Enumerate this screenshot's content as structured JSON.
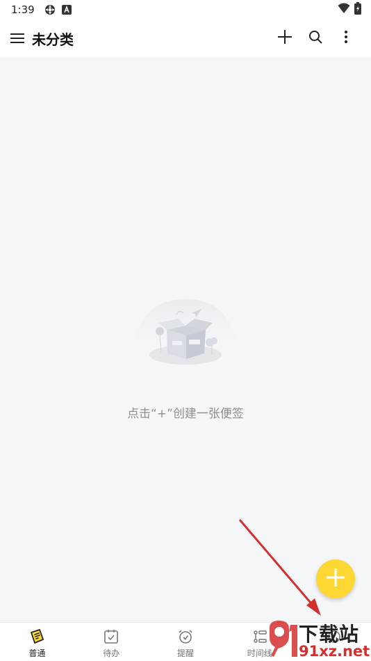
{
  "status_bar": {
    "time": "1:39",
    "icons": [
      "settings-icon",
      "a-badge-icon"
    ],
    "right_icons": [
      "wifi-icon",
      "battery-icon"
    ]
  },
  "app_bar": {
    "title": "未分类",
    "menu_icon": "hamburger-icon",
    "actions": [
      "add-icon",
      "search-icon",
      "more-vert-icon"
    ]
  },
  "empty_state": {
    "message": "点击“+”创建一张便签"
  },
  "fab": {
    "icon": "plus-icon",
    "color": "#fdd835"
  },
  "tabs": [
    {
      "label": "普通",
      "icon": "note-icon",
      "active": true
    },
    {
      "label": "待办",
      "icon": "calendar-check-icon",
      "active": false
    },
    {
      "label": "提醒",
      "icon": "alarm-icon",
      "active": false
    },
    {
      "label": "时间线",
      "icon": "timeline-icon",
      "active": false
    },
    {
      "label": "",
      "icon": "more-tab-icon",
      "active": false
    }
  ],
  "watermark": {
    "text": "下载站",
    "url": "91xz.net"
  },
  "colors": {
    "accent": "#fdd835",
    "arrow": "#d32f2f",
    "background": "#f5f6f8"
  }
}
